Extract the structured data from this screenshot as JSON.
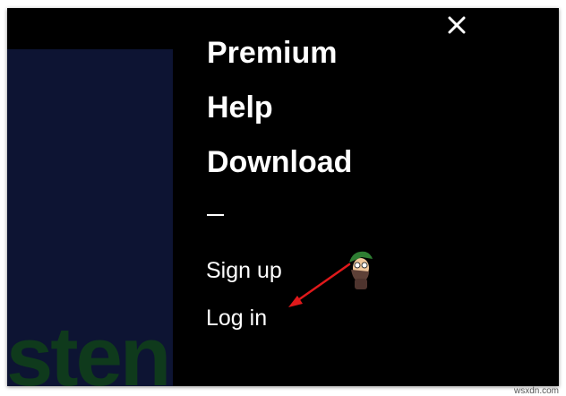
{
  "background": {
    "partial_word": "steni",
    "panel_color": "#0d1433",
    "text_color": "#0f3a1c"
  },
  "menu": {
    "close_icon": "close-icon",
    "items": [
      {
        "label": "Premium"
      },
      {
        "label": "Help"
      },
      {
        "label": "Download"
      }
    ],
    "divider": "—",
    "sub_items": [
      {
        "label": "Sign up"
      },
      {
        "label": "Log in"
      }
    ]
  },
  "annotation": {
    "arrow_color": "#e0191b",
    "mascot": "appuals-mascot-icon"
  },
  "watermark": "wsxdn.com"
}
